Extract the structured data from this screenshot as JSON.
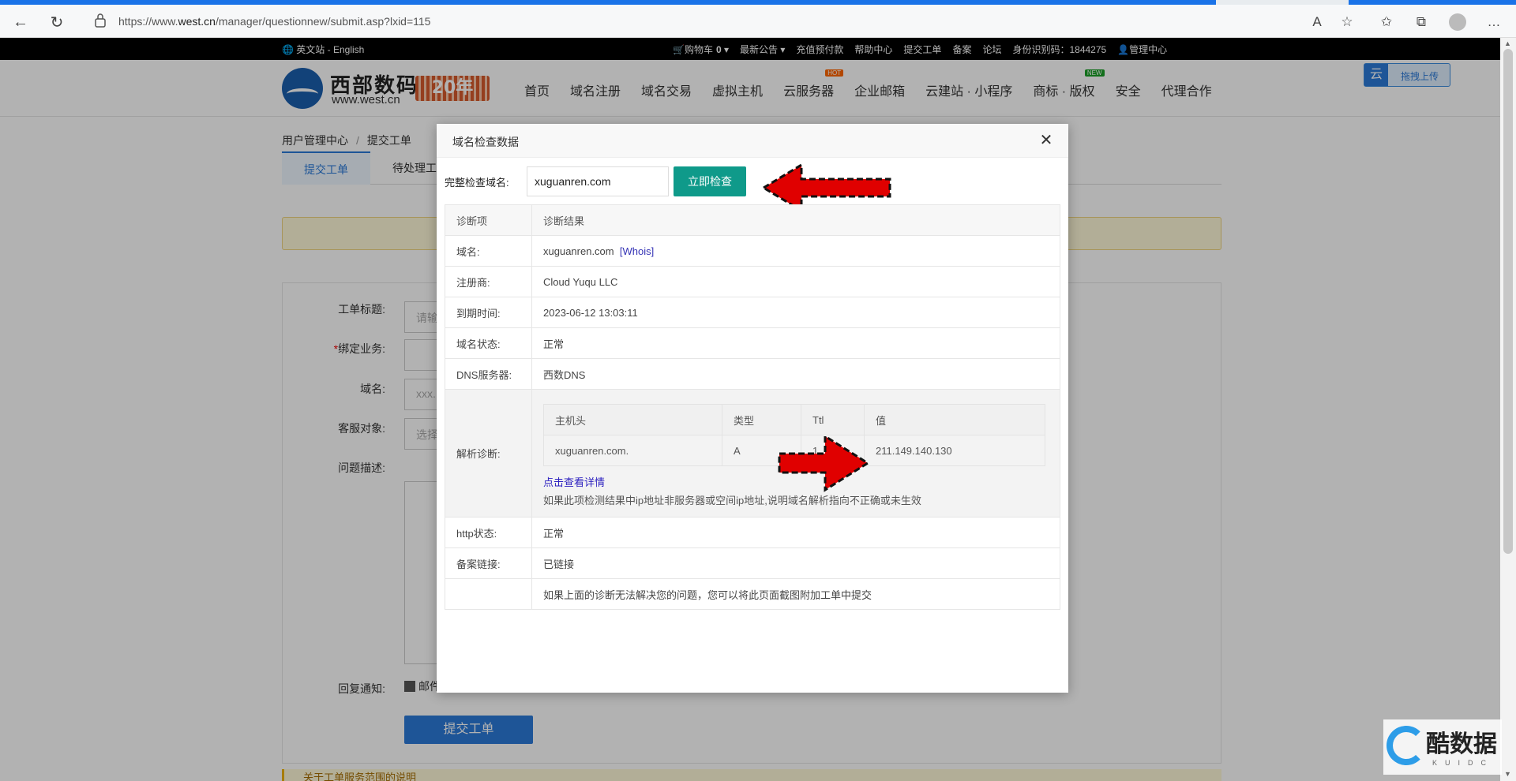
{
  "browser": {
    "url_prefix": "https://www.",
    "url_host": "west.cn",
    "url_path": "/manager/questionnew/submit.asp?lxid=115",
    "icons": [
      "back-icon",
      "refresh-icon",
      "lock-icon",
      "read-aloud-icon",
      "add-favorite-icon",
      "favorites-icon",
      "collections-icon",
      "profile-icon",
      "more-icon"
    ]
  },
  "topbar": {
    "lang": "英文站 - English",
    "cart": "购物车",
    "cart_count": "0",
    "announcements": "最新公告",
    "prepay": "充值预付款",
    "help": "帮助中心",
    "ticket": "提交工单",
    "icp": "备案",
    "forum": "论坛",
    "identity": "身份识别码：1844275",
    "manage": "管理中心"
  },
  "header": {
    "logo_name": "西部数码",
    "logo_url": "www.west.cn",
    "badge": "20年",
    "nav": [
      {
        "label": "首页",
        "tag": ""
      },
      {
        "label": "域名注册",
        "tag": ""
      },
      {
        "label": "域名交易",
        "tag": ""
      },
      {
        "label": "虚拟主机",
        "tag": ""
      },
      {
        "label": "云服务器",
        "tag": "HOT"
      },
      {
        "label": "企业邮箱",
        "tag": ""
      },
      {
        "label": "云建站 · 小程序",
        "tag": ""
      },
      {
        "label": "商标 · 版权",
        "tag": "NEW"
      },
      {
        "label": "安全",
        "tag": ""
      },
      {
        "label": "代理合作",
        "tag": ""
      }
    ],
    "upload": "拖拽上传",
    "upload_icon_text": "云"
  },
  "page": {
    "breadcrumb": [
      "用户管理中心",
      "提交工单"
    ],
    "tabs": [
      "提交工单",
      "待处理工"
    ],
    "form": {
      "title_label": "工单标题:",
      "title_placeholder": "请输",
      "business_label": "绑定业务:",
      "business_required": "*",
      "domain_label": "域名:",
      "domain_placeholder": "xxx.",
      "service_label": "客服对象:",
      "service_placeholder": "选择",
      "desc_label": "问题描述:",
      "notify_label": "回复通知:",
      "notify_option": "邮件",
      "submit": "提交工单"
    },
    "bottom_notice": "关于工单服务范围的说明"
  },
  "modal": {
    "title": "域名检查数据",
    "check_label": "完整检查域名:",
    "check_value": "xuguanren.com",
    "check_button": "立即检查",
    "header": {
      "item": "诊断项",
      "result": "诊断结果"
    },
    "rows": {
      "domain_label": "域名:",
      "domain_value": "xuguanren.com",
      "whois": "[Whois]",
      "registrar_label": "注册商:",
      "registrar_value": "Cloud Yuqu LLC",
      "expiry_label": "到期时间:",
      "expiry_value": "2023-06-12 13:03:11",
      "status_label": "域名状态:",
      "status_value": "正常",
      "dns_label": "DNS服务器:",
      "dns_value": "西数DNS",
      "resolve_label": "解析诊断:",
      "http_label": "http状态:",
      "http_value": "正常",
      "icp_label": "备案链接:",
      "icp_value": "已链接",
      "footer_note": "如果上面的诊断无法解决您的问题，您可以将此页面截图附加工单中提交"
    },
    "resolve": {
      "headers": [
        "主机头",
        "类型",
        "Ttl",
        "值"
      ],
      "record": [
        "xuguanren.com.",
        "A",
        "1",
        "211.149.140.130"
      ],
      "detail_link": "点击查看详情",
      "note": "如果此项检测结果中ip地址非服务器或空间ip地址,说明域名解析指向不正确或未生效"
    }
  },
  "watermark": {
    "text": "酷数据",
    "sub": "KUIDC"
  },
  "colors": {
    "accent": "#2b7ad8",
    "check_button": "#0f9a8a",
    "ok_green": "#1a8f1a",
    "arrow_red": "#e00000"
  }
}
